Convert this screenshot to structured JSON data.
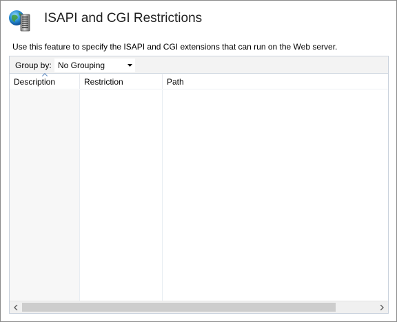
{
  "header": {
    "icon": "isapi-cgi-server-globe-icon",
    "title": "ISAPI and CGI Restrictions"
  },
  "description": "Use this feature to specify the ISAPI and CGI extensions that can run on the Web server.",
  "toolbar": {
    "group_by_label": "Group by:",
    "group_by_value": "No Grouping"
  },
  "table": {
    "columns": [
      "Description",
      "Restriction",
      "Path"
    ],
    "sorted_column": "Description",
    "sort_direction": "ascending",
    "rows": []
  },
  "colors": {
    "title": "#1e1e1e",
    "panel_border": "#c9d1dc",
    "toolbar_bg": "#f3f3f3",
    "scroll_thumb": "#cdcdcd"
  }
}
